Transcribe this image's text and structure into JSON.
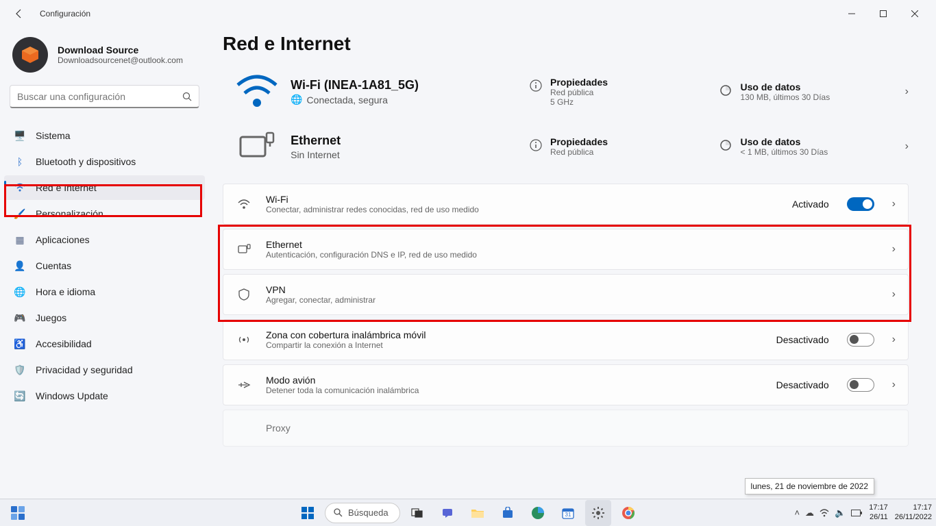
{
  "window": {
    "title": "Configuración"
  },
  "user": {
    "name": "Download Source",
    "email": "Downloadsourcenet@outlook.com"
  },
  "search": {
    "placeholder": "Buscar una configuración"
  },
  "sidebar": {
    "items": [
      {
        "label": "Sistema"
      },
      {
        "label": "Bluetooth y dispositivos"
      },
      {
        "label": "Red e Internet"
      },
      {
        "label": "Personalización"
      },
      {
        "label": "Aplicaciones"
      },
      {
        "label": "Cuentas"
      },
      {
        "label": "Hora e idioma"
      },
      {
        "label": "Juegos"
      },
      {
        "label": "Accesibilidad"
      },
      {
        "label": "Privacidad y seguridad"
      },
      {
        "label": "Windows Update"
      }
    ]
  },
  "page": {
    "title": "Red e Internet"
  },
  "wifi_status": {
    "heading": "Wi-Fi (INEA-1A81_5G)",
    "sub": "Conectada, segura",
    "properties": {
      "title": "Propiedades",
      "line1": "Red pública",
      "line2": "5 GHz"
    },
    "data": {
      "title": "Uso de datos",
      "line1": "130 MB, últimos 30 Días"
    }
  },
  "eth_status": {
    "heading": "Ethernet",
    "sub": "Sin Internet",
    "properties": {
      "title": "Propiedades",
      "line1": "Red pública"
    },
    "data": {
      "title": "Uso de datos",
      "line1": "< 1 MB, últimos 30 Días"
    }
  },
  "cards": {
    "wifi": {
      "title": "Wi-Fi",
      "sub": "Conectar, administrar redes conocidas, red de uso medido",
      "state": "Activado"
    },
    "ethernet": {
      "title": "Ethernet",
      "sub": "Autenticación, configuración DNS e IP, red de uso medido"
    },
    "vpn": {
      "title": "VPN",
      "sub": "Agregar, conectar, administrar"
    },
    "hotspot": {
      "title": "Zona con cobertura inalámbrica móvil",
      "sub": "Compartir la conexión a Internet",
      "state": "Desactivado"
    },
    "airplane": {
      "title": "Modo avión",
      "sub": "Detener toda la comunicación inalámbrica",
      "state": "Desactivado"
    },
    "proxy": {
      "title": "Proxy"
    }
  },
  "taskbar": {
    "search": "Búsqueda"
  },
  "tray": {
    "tooltip": "lunes, 21 de noviembre de 2022",
    "time": "17:17",
    "date_small": "26/11",
    "date": "26/11/2022"
  }
}
